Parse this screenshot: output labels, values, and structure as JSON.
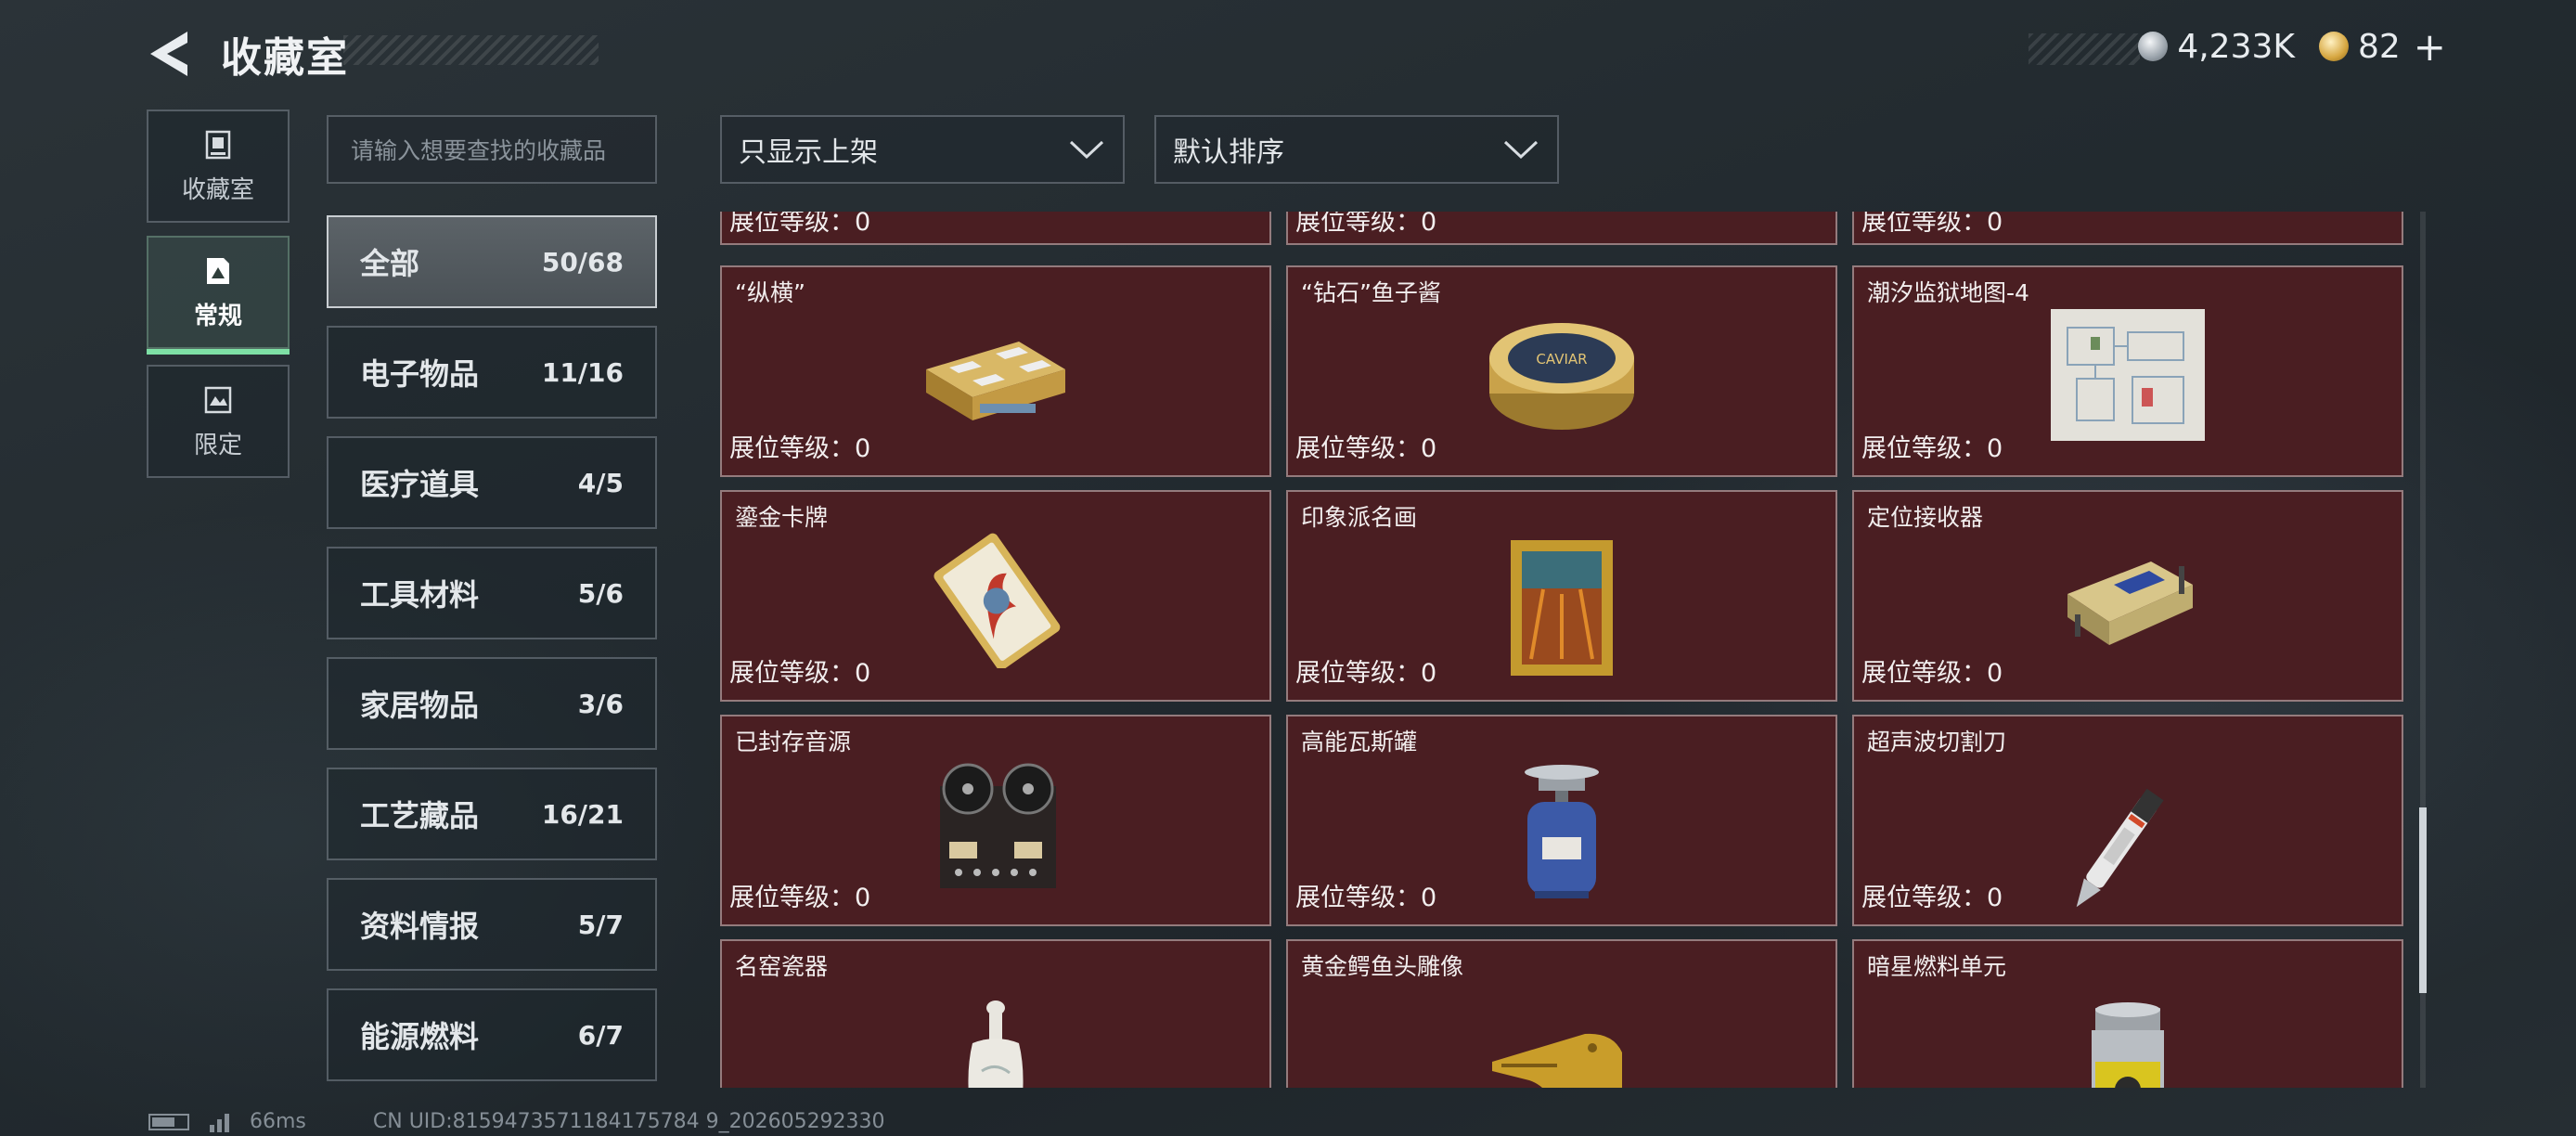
{
  "header": {
    "title": "收藏室",
    "currency": [
      {
        "icon": "silver-coin-icon",
        "value": "4,233K"
      },
      {
        "icon": "gold-coin-icon",
        "value": "82"
      }
    ],
    "add_symbol": "+"
  },
  "nav": {
    "tabs": [
      {
        "label": "收藏室",
        "icon": "collection-icon",
        "active": false
      },
      {
        "label": "常规",
        "icon": "regular-icon",
        "active": true
      },
      {
        "label": "限定",
        "icon": "limited-icon",
        "active": false
      }
    ]
  },
  "search": {
    "placeholder": "请输入想要查找的收藏品"
  },
  "categories": [
    {
      "label": "全部",
      "count": "50/68",
      "active": true
    },
    {
      "label": "电子物品",
      "count": "11/16"
    },
    {
      "label": "医疗道具",
      "count": "4/5"
    },
    {
      "label": "工具材料",
      "count": "5/6"
    },
    {
      "label": "家居物品",
      "count": "3/6"
    },
    {
      "label": "工艺藏品",
      "count": "16/21"
    },
    {
      "label": "资料情报",
      "count": "5/7"
    },
    {
      "label": "能源燃料",
      "count": "6/7"
    }
  ],
  "filters": {
    "display": "只显示上架",
    "sort": "默认排序"
  },
  "level_label": "展位等级：",
  "partial_row": [
    {
      "level": "0"
    },
    {
      "level": "0"
    },
    {
      "level": "0"
    }
  ],
  "items": [
    {
      "name": "“纵横”",
      "level": "0",
      "icon": "chess-box-icon"
    },
    {
      "name": "“钻石”鱼子酱",
      "level": "0",
      "icon": "caviar-tin-icon"
    },
    {
      "name": "潮汐监狱地图-4",
      "level": "0",
      "icon": "map-icon"
    },
    {
      "name": "鎏金卡牌",
      "level": "0",
      "icon": "gilded-card-icon"
    },
    {
      "name": "印象派名画",
      "level": "0",
      "icon": "painting-icon"
    },
    {
      "name": "定位接收器",
      "level": "0",
      "icon": "receiver-icon"
    },
    {
      "name": "已封存音源",
      "level": "0",
      "icon": "tape-recorder-icon"
    },
    {
      "name": "高能瓦斯罐",
      "level": "0",
      "icon": "gas-canister-icon"
    },
    {
      "name": "超声波切割刀",
      "level": "0",
      "icon": "cutter-knife-icon"
    },
    {
      "name": "名窑瓷器",
      "level": "",
      "icon": "porcelain-vase-icon"
    },
    {
      "name": "黄金鳄鱼头雕像",
      "level": "",
      "icon": "croc-statue-icon"
    },
    {
      "name": "暗星燃料单元",
      "level": "",
      "icon": "fuel-cell-icon"
    }
  ],
  "footer": {
    "ping": "66ms",
    "uid": "CN UID:8159473571184175784 9_202605292330"
  }
}
